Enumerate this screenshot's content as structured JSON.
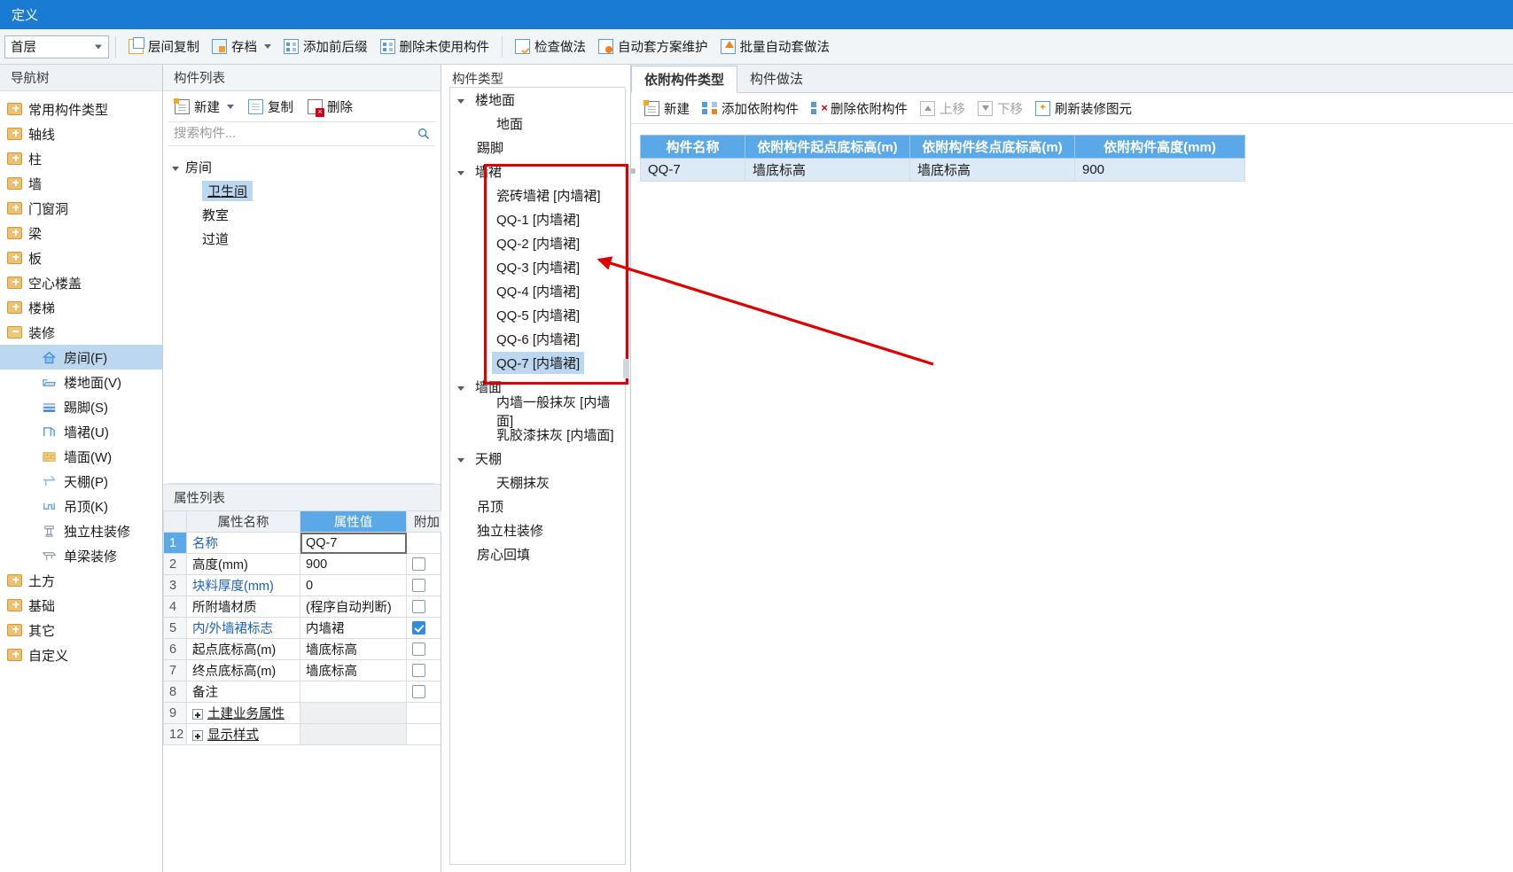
{
  "window": {
    "title": "定义"
  },
  "toolbar": {
    "floor_value": "首层",
    "buttons": [
      {
        "label": "层间复制",
        "icon": "copy-layer-icon",
        "dropdown": false
      },
      {
        "label": "存档",
        "icon": "archive-icon",
        "dropdown": true
      },
      {
        "label": "添加前后缀",
        "icon": "add-affix-icon",
        "dropdown": false
      },
      {
        "label": "删除未使用构件",
        "icon": "delete-unused-icon",
        "dropdown": false
      },
      {
        "label": "检查做法",
        "icon": "check-method-icon",
        "dropdown": false
      },
      {
        "label": "自动套方案维护",
        "icon": "auto-plan-icon",
        "dropdown": false
      },
      {
        "label": "批量自动套做法",
        "icon": "batch-auto-icon",
        "dropdown": false
      }
    ]
  },
  "nav": {
    "title": "导航树",
    "items": [
      {
        "label": "常用构件类型",
        "icon": "folder-icon",
        "level": 0,
        "selected": false
      },
      {
        "label": "轴线",
        "icon": "folder-icon",
        "level": 0,
        "selected": false
      },
      {
        "label": "柱",
        "icon": "folder-icon",
        "level": 0,
        "selected": false
      },
      {
        "label": "墙",
        "icon": "folder-icon",
        "level": 0,
        "selected": false
      },
      {
        "label": "门窗洞",
        "icon": "folder-icon",
        "level": 0,
        "selected": false
      },
      {
        "label": "梁",
        "icon": "folder-icon",
        "level": 0,
        "selected": false
      },
      {
        "label": "板",
        "icon": "folder-icon",
        "level": 0,
        "selected": false
      },
      {
        "label": "空心楼盖",
        "icon": "folder-icon",
        "level": 0,
        "selected": false
      },
      {
        "label": "楼梯",
        "icon": "folder-icon",
        "level": 0,
        "selected": false
      },
      {
        "label": "装修",
        "icon": "folder-open-icon",
        "level": 0,
        "selected": false
      },
      {
        "label": "房间(F)",
        "icon": "room-icon",
        "level": 1,
        "selected": true
      },
      {
        "label": "楼地面(V)",
        "icon": "floor-icon",
        "level": 1,
        "selected": false
      },
      {
        "label": "踢脚(S)",
        "icon": "skirting-icon",
        "level": 1,
        "selected": false
      },
      {
        "label": "墙裙(U)",
        "icon": "wainscot-icon",
        "level": 1,
        "selected": false
      },
      {
        "label": "墙面(W)",
        "icon": "wallface-icon",
        "level": 1,
        "selected": false
      },
      {
        "label": "天棚(P)",
        "icon": "ceiling-icon",
        "level": 1,
        "selected": false
      },
      {
        "label": "吊顶(K)",
        "icon": "suspended-ceiling-icon",
        "level": 1,
        "selected": false
      },
      {
        "label": "独立柱装修",
        "icon": "column-decor-icon",
        "level": 1,
        "selected": false
      },
      {
        "label": "单梁装修",
        "icon": "beam-decor-icon",
        "level": 1,
        "selected": false
      },
      {
        "label": "土方",
        "icon": "folder-icon",
        "level": 0,
        "selected": false
      },
      {
        "label": "基础",
        "icon": "folder-icon",
        "level": 0,
        "selected": false
      },
      {
        "label": "其它",
        "icon": "folder-icon",
        "level": 0,
        "selected": false
      },
      {
        "label": "自定义",
        "icon": "folder-icon",
        "level": 0,
        "selected": false
      }
    ]
  },
  "component_list": {
    "title": "构件列表",
    "toolbar": [
      {
        "label": "新建",
        "icon": "new-icon",
        "dropdown": true
      },
      {
        "label": "复制",
        "icon": "copy-icon",
        "dropdown": false
      },
      {
        "label": "删除",
        "icon": "delete-icon",
        "dropdown": false
      }
    ],
    "search_placeholder": "搜索构件...",
    "search_value": "",
    "tree": [
      {
        "label": "房间",
        "level": 0,
        "expanded": true,
        "selected": false
      },
      {
        "label": "卫生间",
        "level": 1,
        "expanded": false,
        "selected": true
      },
      {
        "label": "教室",
        "level": 1,
        "expanded": false,
        "selected": false
      },
      {
        "label": "过道",
        "level": 1,
        "expanded": false,
        "selected": false
      }
    ]
  },
  "property_list": {
    "title": "属性列表",
    "headers": [
      "",
      "属性名称",
      "属性值",
      "附加"
    ],
    "rows": [
      {
        "idx": "1",
        "name": "名称",
        "value": "QQ-7",
        "name_blue": true,
        "editing": true,
        "checkbox": null,
        "idx_selected": true
      },
      {
        "idx": "2",
        "name": "高度(mm)",
        "value": "900",
        "name_blue": false,
        "editing": false,
        "checkbox": false,
        "idx_selected": false
      },
      {
        "idx": "3",
        "name": "块料厚度(mm)",
        "value": "0",
        "name_blue": true,
        "editing": false,
        "checkbox": false,
        "idx_selected": false
      },
      {
        "idx": "4",
        "name": "所附墙材质",
        "value": "(程序自动判断)",
        "name_blue": false,
        "editing": false,
        "checkbox": false,
        "idx_selected": false
      },
      {
        "idx": "5",
        "name": "内/外墙裙标志",
        "value": "内墙裙",
        "name_blue": true,
        "editing": false,
        "checkbox": true,
        "idx_selected": false
      },
      {
        "idx": "6",
        "name": "起点底标高(m)",
        "value": "墙底标高",
        "name_blue": false,
        "editing": false,
        "checkbox": false,
        "idx_selected": false
      },
      {
        "idx": "7",
        "name": "终点底标高(m)",
        "value": "墙底标高",
        "name_blue": false,
        "editing": false,
        "checkbox": false,
        "idx_selected": false
      },
      {
        "idx": "8",
        "name": "备注",
        "value": "",
        "name_blue": false,
        "editing": false,
        "checkbox": false,
        "idx_selected": false
      },
      {
        "idx": "9",
        "name": "土建业务属性",
        "value": "",
        "name_blue": false,
        "editing": false,
        "checkbox": null,
        "expandable": true,
        "idx_selected": false
      },
      {
        "idx": "12",
        "name": "显示样式",
        "value": "",
        "name_blue": false,
        "editing": false,
        "checkbox": null,
        "expandable": true,
        "idx_selected": false
      }
    ]
  },
  "component_type": {
    "title": "构件类型",
    "items": [
      {
        "label": "楼地面",
        "level": 1,
        "expanded": true,
        "selected": false
      },
      {
        "label": "地面",
        "level": 2,
        "expanded": false,
        "selected": false
      },
      {
        "label": "踢脚",
        "level": 1,
        "expanded": false,
        "selected": false
      },
      {
        "label": "墙裙",
        "level": 1,
        "expanded": true,
        "selected": false
      },
      {
        "label": "瓷砖墙裙 [内墙裙]",
        "level": 2,
        "expanded": false,
        "selected": false
      },
      {
        "label": "QQ-1 [内墙裙]",
        "level": 2,
        "expanded": false,
        "selected": false
      },
      {
        "label": "QQ-2 [内墙裙]",
        "level": 2,
        "expanded": false,
        "selected": false
      },
      {
        "label": "QQ-3 [内墙裙]",
        "level": 2,
        "expanded": false,
        "selected": false
      },
      {
        "label": "QQ-4 [内墙裙]",
        "level": 2,
        "expanded": false,
        "selected": false
      },
      {
        "label": "QQ-5 [内墙裙]",
        "level": 2,
        "expanded": false,
        "selected": false
      },
      {
        "label": "QQ-6 [内墙裙]",
        "level": 2,
        "expanded": false,
        "selected": false
      },
      {
        "label": "QQ-7 [内墙裙]",
        "level": 2,
        "expanded": false,
        "selected": true
      },
      {
        "label": "墙面",
        "level": 1,
        "expanded": true,
        "selected": false
      },
      {
        "label": "内墙一般抹灰 [内墙面]",
        "level": 2,
        "expanded": false,
        "selected": false
      },
      {
        "label": "乳胶漆抹灰 [内墙面]",
        "level": 2,
        "expanded": false,
        "selected": false
      },
      {
        "label": "天棚",
        "level": 1,
        "expanded": true,
        "selected": false
      },
      {
        "label": "天棚抹灰",
        "level": 2,
        "expanded": false,
        "selected": false
      },
      {
        "label": "吊顶",
        "level": 1,
        "expanded": false,
        "selected": false
      },
      {
        "label": "独立柱装修",
        "level": 1,
        "expanded": false,
        "selected": false
      },
      {
        "label": "房心回填",
        "level": 1,
        "expanded": false,
        "selected": false
      }
    ]
  },
  "right_panel": {
    "tabs": [
      {
        "label": "依附构件类型",
        "active": true
      },
      {
        "label": "构件做法",
        "active": false
      }
    ],
    "toolbar": [
      {
        "label": "新建",
        "icon": "new-icon",
        "disabled": false
      },
      {
        "label": "添加依附构件",
        "icon": "add-attached-icon",
        "disabled": false
      },
      {
        "label": "删除依附构件",
        "icon": "delete-attached-icon",
        "disabled": false
      },
      {
        "label": "上移",
        "icon": "move-up-icon",
        "disabled": true
      },
      {
        "label": "下移",
        "icon": "move-down-icon",
        "disabled": true
      },
      {
        "label": "刷新装修图元",
        "icon": "refresh-icon",
        "disabled": false
      }
    ],
    "grid": {
      "headers": [
        "构件名称",
        "依附构件起点底标高(m)",
        "依附构件终点底标高(m)",
        "依附构件高度(mm)"
      ],
      "rows": [
        [
          "QQ-7",
          "墙底标高",
          "墙底标高",
          "900"
        ]
      ]
    }
  },
  "annotations": {
    "highlight_color": "#e00000",
    "arrow_color": "#e00000"
  }
}
